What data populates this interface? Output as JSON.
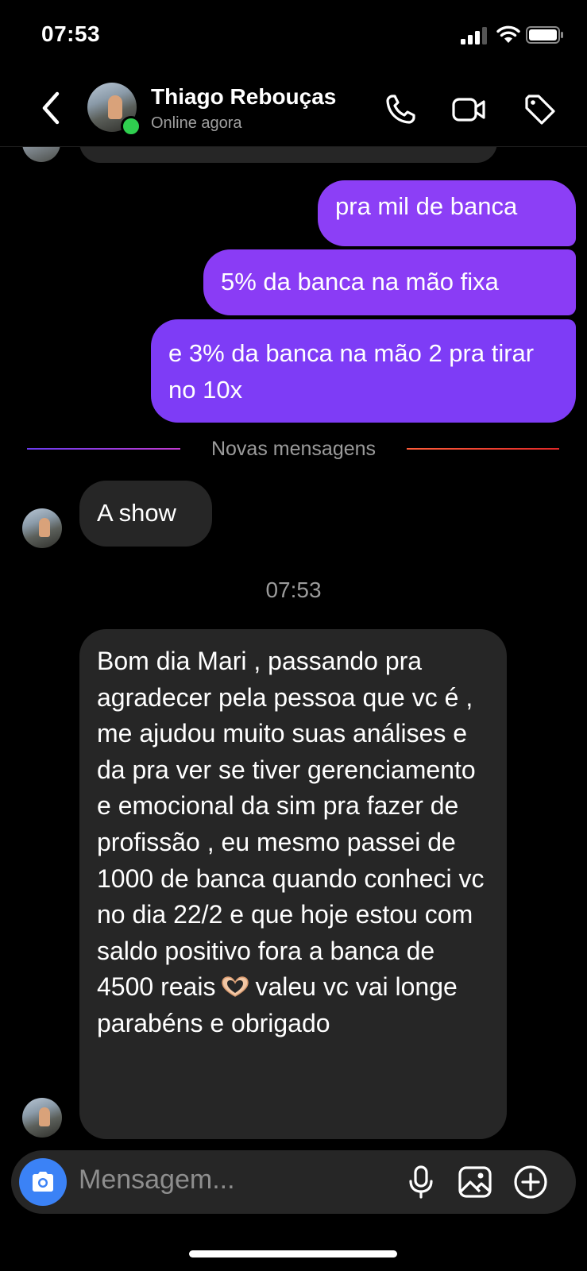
{
  "status_bar": {
    "time": "07:53"
  },
  "header": {
    "contact_name": "Thiago Rebouças",
    "presence": "Online agora",
    "icons": [
      "back-icon",
      "phone-icon",
      "video-icon",
      "tag-icon"
    ]
  },
  "messages": {
    "outgoing": [
      "pra mil de banca",
      "5% da banca na mão fixa",
      "e 3% da banca na mão 2 pra tirar no 10x"
    ],
    "divider_label": "Novas mensagens",
    "incoming_1": "A show",
    "timestamp": "07:53",
    "incoming_2_before_emoji": "Bom dia Mari , passando pra agradecer pela pessoa que vc é , me ajudou muito suas análises e da pra ver se tiver gerenciamento e emocional da sim pra fazer de profissão , eu mesmo passei de 1000 de banca quando conheci vc no dia 22/2 e que hoje estou com saldo positivo fora a banca de 4500 reais",
    "incoming_2_emoji": "heart-hands-emoji",
    "incoming_2_after_emoji": "valeu vc vai longe parabéns e obrigado"
  },
  "composer": {
    "placeholder": "Mensagem...",
    "icons": [
      "camera-icon",
      "microphone-icon",
      "gallery-icon",
      "plus-icon"
    ]
  },
  "colors": {
    "background": "#000000",
    "outgoing_bubble": "#8a3cf5",
    "incoming_bubble": "#262626",
    "online_dot": "#2fcf4f",
    "camera_button": "#3b82f6"
  }
}
